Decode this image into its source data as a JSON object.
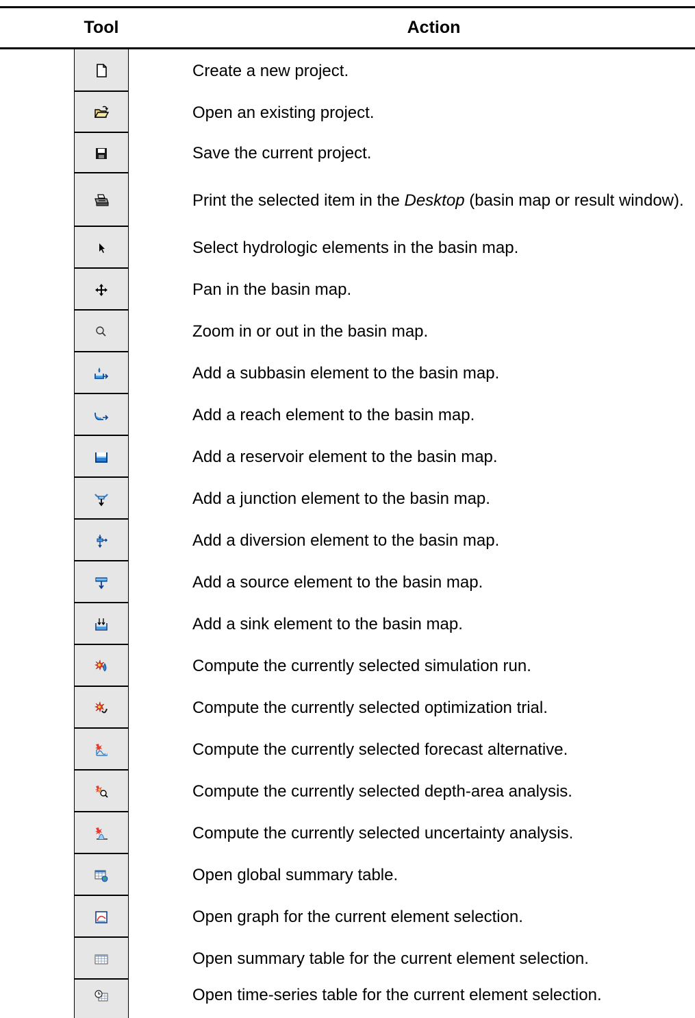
{
  "header": {
    "tool": "Tool",
    "action": "Action"
  },
  "rows": [
    {
      "icon": "new-document-icon",
      "text": "Create a new project."
    },
    {
      "icon": "open-folder-icon",
      "text": "Open an existing project."
    },
    {
      "icon": "save-disk-icon",
      "text": "Save the current project."
    },
    {
      "icon": "printer-icon",
      "text_before": "Print the selected item in the ",
      "text_italic": "Desktop",
      "text_after": " (basin map or result window)."
    },
    {
      "icon": "arrow-cursor-icon",
      "text": "Select hydrologic elements in the basin map."
    },
    {
      "icon": "pan-arrows-icon",
      "text": "Pan in the basin map."
    },
    {
      "icon": "magnifier-icon",
      "text": "Zoom in or out in the basin map."
    },
    {
      "icon": "subbasin-icon",
      "text": "Add a subbasin element to the basin map."
    },
    {
      "icon": "reach-icon",
      "text": "Add a reach element to the basin map."
    },
    {
      "icon": "reservoir-icon",
      "text": "Add a reservoir element to the basin map."
    },
    {
      "icon": "junction-icon",
      "text": "Add a junction element to the basin map."
    },
    {
      "icon": "diversion-icon",
      "text": "Add a diversion element to the basin map."
    },
    {
      "icon": "source-icon",
      "text": "Add a source element to the basin map."
    },
    {
      "icon": "sink-icon",
      "text": "Add a sink element to the basin map."
    },
    {
      "icon": "compute-simulation-icon",
      "text": "Compute the currently selected simulation run."
    },
    {
      "icon": "compute-optimization-icon",
      "text": "Compute the currently selected optimization trial."
    },
    {
      "icon": "compute-forecast-icon",
      "text": "Compute the currently selected forecast alternative."
    },
    {
      "icon": "compute-depth-area-icon",
      "text": "Compute the currently selected depth-area analysis."
    },
    {
      "icon": "compute-uncertainty-icon",
      "text": "Compute the currently selected uncertainty analysis."
    },
    {
      "icon": "global-summary-table-icon",
      "text": "Open global summary table."
    },
    {
      "icon": "graph-icon",
      "text": "Open graph for the current element selection."
    },
    {
      "icon": "summary-table-icon",
      "text": "Open summary table for the current element selection."
    },
    {
      "icon": "time-series-table-icon",
      "text": "Open time-series table for the current element selection."
    }
  ]
}
